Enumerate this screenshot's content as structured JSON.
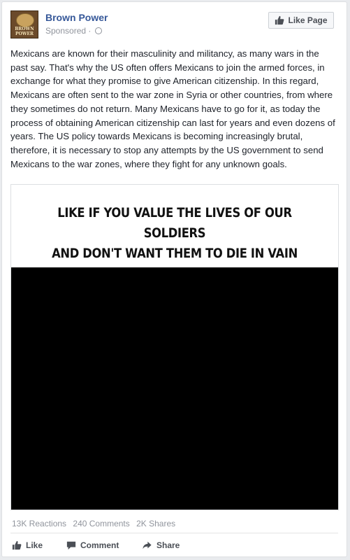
{
  "post": {
    "page_name": "Brown Power",
    "sponsored_label": "Sponsored",
    "meta_separator": "·",
    "avatar_text": "BROWN POWER",
    "like_page_label": "Like Page",
    "body": "Mexicans are known for their masculinity and militancy, as many wars in the past say. That's why the US often offers Mexicans to join the armed forces, in exchange for what they promise to give American citizenship. In this regard, Mexicans are often sent to the war zone in Syria or other countries, from where they sometimes do not return. Many Mexicans have to go for it, as today the process of obtaining American citizenship can last for years and even dozens of years. The US policy towards Mexicans is becoming increasingly brutal, therefore, it is necessary to stop any attempts by the US government to send Mexicans to the war zones, where they fight for any unknown goals.",
    "image_caption_line1": "LIKE IF YOU VALUE THE LIVES OF OUR SOLDIERS",
    "image_caption_line2": "AND DON'T WANT THEM TO DIE IN VAIN"
  },
  "stats": {
    "reactions": "13K Reactions",
    "comments": "240 Comments",
    "shares": "2K Shares"
  },
  "actions": {
    "like": "Like",
    "comment": "Comment",
    "share": "Share"
  },
  "icons": {
    "page_like": "thumbs-up-icon",
    "like": "thumbs-up-icon",
    "comment": "speech-bubble-icon",
    "share": "share-arrow-icon",
    "audience": "globe-icon"
  },
  "colors": {
    "link": "#365899",
    "meta": "#90949c",
    "text": "#1d2129"
  }
}
